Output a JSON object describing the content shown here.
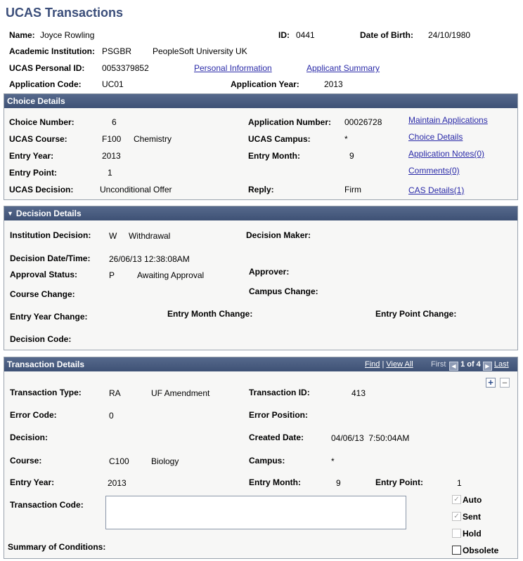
{
  "page": {
    "title": "UCAS Transactions"
  },
  "header": {
    "name_label": "Name:",
    "name": "Joyce Rowling",
    "id_label": "ID:",
    "id": "0441",
    "dob_label": "Date of Birth:",
    "dob": "24/10/1980",
    "inst_label": "Academic Institution:",
    "inst_code": "PSGBR",
    "inst_name": "PeopleSoft University UK",
    "ucas_pid_label": "UCAS Personal ID:",
    "ucas_pid": "0053379852",
    "personal_info_link": "Personal Information",
    "applicant_summary_link": "Applicant Summary",
    "app_code_label": "Application Code:",
    "app_code": "UC01",
    "app_year_label": "Application Year:",
    "app_year": "2013"
  },
  "choice": {
    "header": "Choice Details",
    "choice_num_label": "Choice Number:",
    "choice_num": "6",
    "app_num_label": "Application Number:",
    "app_num": "00026728",
    "ucas_course_label": "UCAS Course:",
    "ucas_course_code": "F100",
    "ucas_course_name": "Chemistry",
    "ucas_campus_label": "UCAS Campus:",
    "ucas_campus": "*",
    "entry_year_label": "Entry Year:",
    "entry_year": "2013",
    "entry_month_label": "Entry Month:",
    "entry_month": "9",
    "entry_point_label": "Entry Point:",
    "entry_point": "1",
    "ucas_decision_label": "UCAS Decision:",
    "ucas_decision": "Unconditional Offer",
    "reply_label": "Reply:",
    "reply": "Firm",
    "links": {
      "maintain": "Maintain Applications",
      "choice_details": "Choice Details",
      "app_notes": "Application Notes(0)",
      "comments": "Comments(0)",
      "cas": "CAS Details(1)"
    }
  },
  "decision": {
    "header": "Decision Details",
    "inst_decision_label": "Institution Decision:",
    "inst_decision_code": "W",
    "inst_decision": "Withdrawal",
    "decision_maker_label": "Decision Maker:",
    "date_label": "Decision Date/Time:",
    "date": "26/06/13 12:38:08AM",
    "approval_label": "Approval Status:",
    "approval_code": "P",
    "approval": "Awaiting Approval",
    "approver_label": "Approver:",
    "course_change_label": "Course Change:",
    "campus_change_label": "Campus Change:",
    "entry_year_change_label": "Entry Year Change:",
    "entry_month_change_label": "Entry Month Change:",
    "entry_point_change_label": "Entry Point Change:",
    "decision_code_label": "Decision Code:"
  },
  "transaction": {
    "header": "Transaction Details",
    "find": "Find",
    "view_all": "View All",
    "sep": "|",
    "first": "First",
    "count": "1 of 4",
    "last": "Last",
    "type_label": "Transaction Type:",
    "type_code": "RA",
    "type": "UF Amendment",
    "tid_label": "Transaction ID:",
    "tid": "413",
    "error_code_label": "Error Code:",
    "error_code": "0",
    "error_pos_label": "Error Position:",
    "decision_label": "Decision:",
    "created_label": "Created Date:",
    "created": "04/06/13  7:50:04AM",
    "course_label": "Course:",
    "course_code": "C100",
    "course_name": "Biology",
    "campus_label": "Campus:",
    "campus": "*",
    "entry_year_label": "Entry Year:",
    "entry_year": "2013",
    "entry_month_label": "Entry Month:",
    "entry_month": "9",
    "entry_point_label": "Entry Point:",
    "entry_point": "1",
    "code_label": "Transaction Code:",
    "code_value": "",
    "summary_label": "Summary of Conditions:",
    "auto_label": "Auto",
    "sent_label": "Sent",
    "hold_label": "Hold",
    "obsolete_label": "Obsolete",
    "auto_checked": true,
    "sent_checked": true,
    "hold_checked": false,
    "obsolete_checked": false
  }
}
